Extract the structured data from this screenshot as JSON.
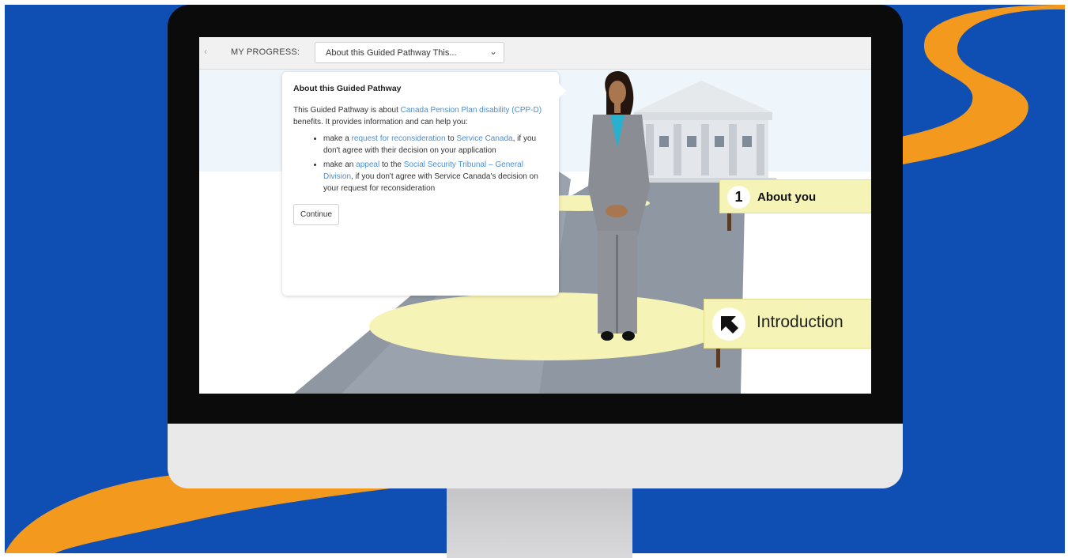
{
  "progress": {
    "label": "MY PROGRESS:",
    "selected": "About this Guided Pathway This...",
    "back_icon": "chevron-left-icon",
    "chevron_icon": "chevron-down-icon"
  },
  "card": {
    "title": "About this Guided Pathway",
    "intro_prefix": "This Guided Pathway is about ",
    "intro_link": "Canada Pension Plan disability (CPP-D)",
    "intro_suffix": " benefits. It provides information and can help you:",
    "items": [
      {
        "pre": "make a ",
        "link1": "request for reconsideration",
        "mid": " to ",
        "link2": "Service Canada",
        "post": ", if you don't agree with their decision on your application"
      },
      {
        "pre": "make an ",
        "link1": "appeal",
        "mid": " to the ",
        "link2": "Social Security Tribunal – General Division",
        "post": ", if you don't agree with Service Canada's decision on your request for reconsideration"
      }
    ],
    "continue_label": "Continue"
  },
  "signs": {
    "about_number": "1",
    "about_label": "About you",
    "intro_label": "Introduction",
    "intro_icon": "arrow-up-left-icon"
  },
  "colors": {
    "background_blue": "#0f4fb3",
    "river_orange": "#f39a1e",
    "sign_yellow": "#f6f3b6",
    "link_blue": "#4a8fd0"
  }
}
